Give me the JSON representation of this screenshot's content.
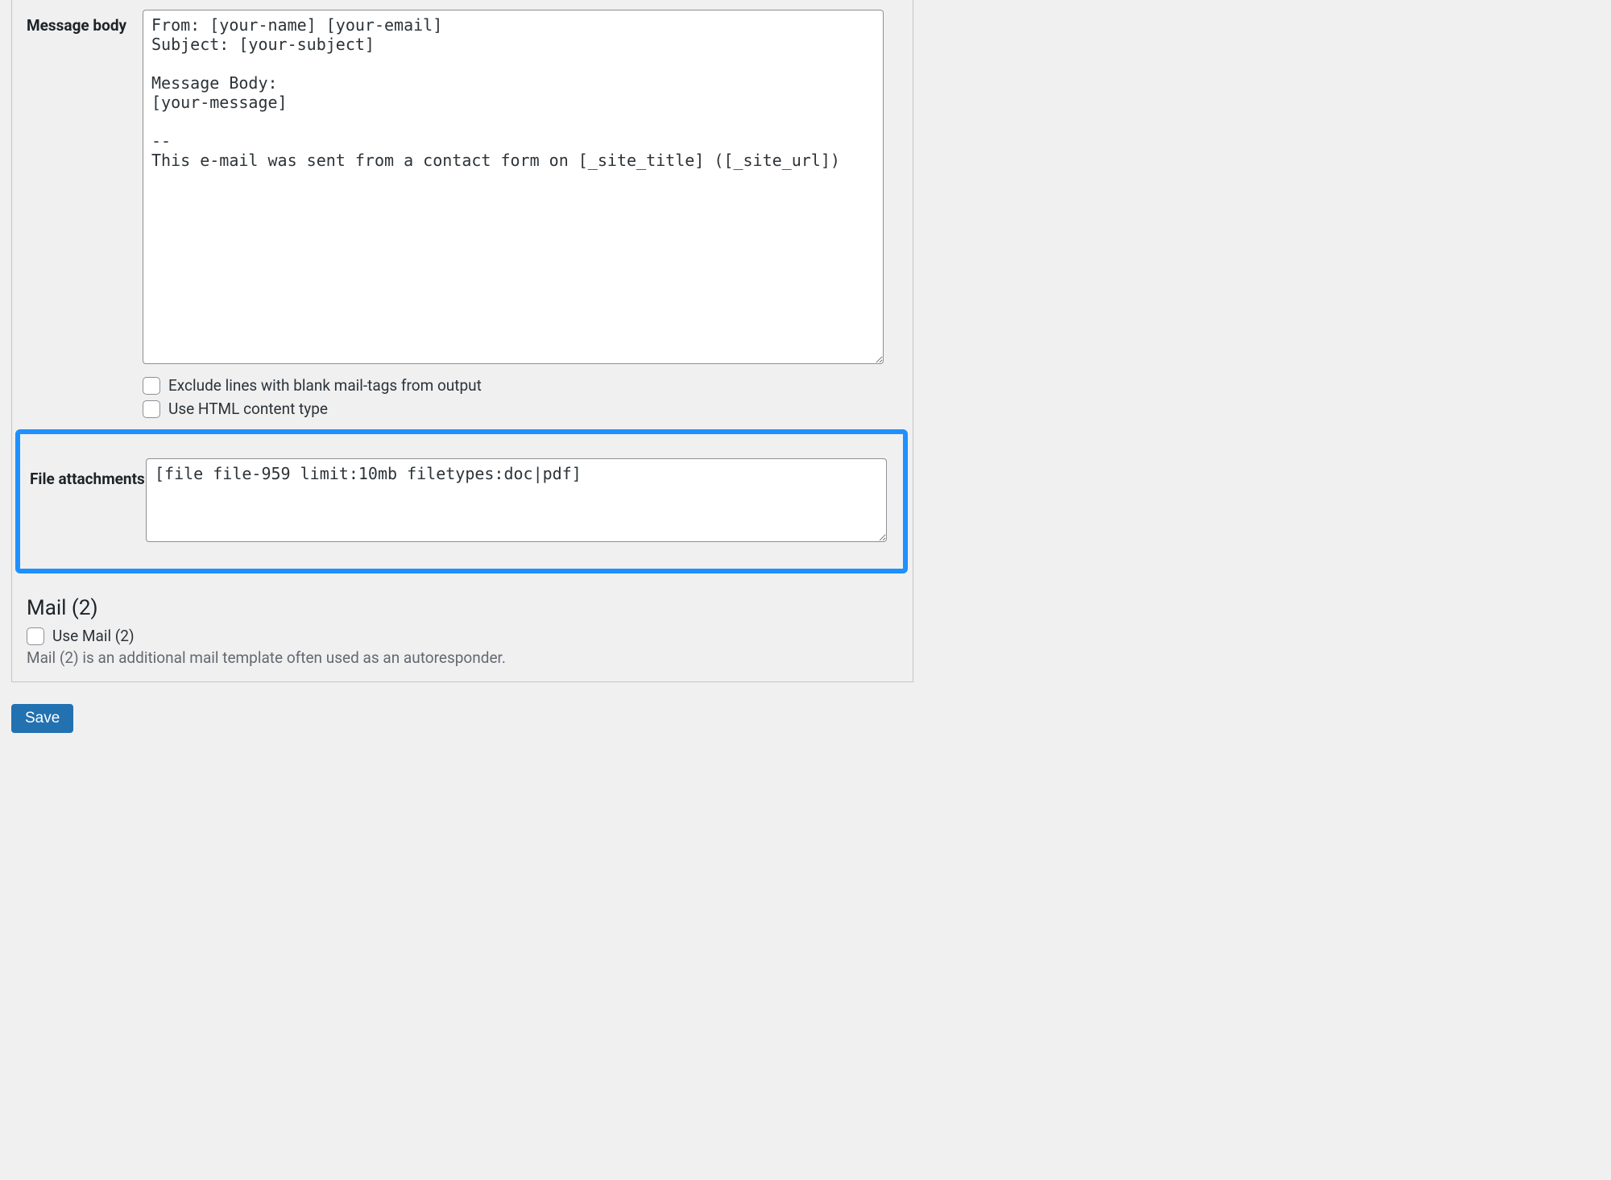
{
  "message_body": {
    "label": "Message body",
    "value": "From: [your-name] [your-email]\nSubject: [your-subject]\n\nMessage Body:\n[your-message]\n\n-- \nThis e-mail was sent from a contact form on [_site_title] ([_site_url])"
  },
  "exclude_blank": {
    "label": "Exclude lines with blank mail-tags from output",
    "checked": false
  },
  "use_html": {
    "label": "Use HTML content type",
    "checked": false
  },
  "file_attachments": {
    "label": "File attachments",
    "value": "[file file-959 limit:10mb filetypes:doc|pdf]"
  },
  "mail2": {
    "heading": "Mail (2)",
    "use_label": "Use Mail (2)",
    "use_checked": false,
    "description": "Mail (2) is an additional mail template often used as an autoresponder."
  },
  "save_label": "Save",
  "colors": {
    "highlight": "#1e90ff",
    "button": "#2271b1"
  }
}
